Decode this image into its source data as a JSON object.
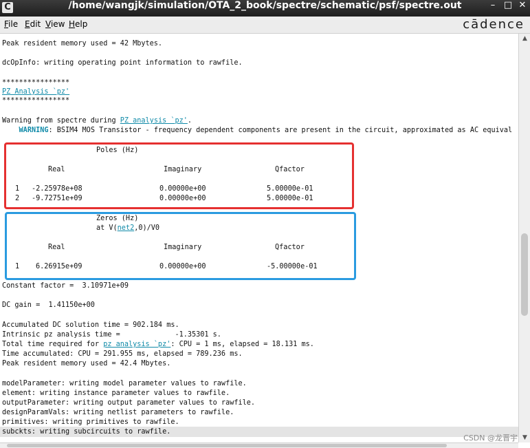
{
  "window": {
    "title": "/home/wangjk/simulation/OTA_2_book/spectre/schematic/psf/spectre.out",
    "controls": {
      "minimize": "–",
      "maximize": "□",
      "close": "✕"
    }
  },
  "menubar": {
    "file": {
      "u": "F",
      "rest": "ile"
    },
    "edit": {
      "u": "E",
      "rest": "dit"
    },
    "view": {
      "u": "V",
      "rest": "iew"
    },
    "help": {
      "u": "H",
      "rest": "elp"
    },
    "brand": "cādence"
  },
  "log": {
    "l1": "Peak resident memory used = 42 Mbytes.",
    "l2": "dcOpInfo: writing operating point information to rawfile.",
    "stars": "****************",
    "pz_heading": "PZ Analysis `pz'",
    "warn_prefix": "Warning from spectre during ",
    "warn_link": "PZ analysis `pz'",
    "warn_suffix": ".",
    "warning_label": "WARNING",
    "warning_text": ": BSIM4 MOS Transistor - frequency dependent components are present in the circuit, approximated as AC equival"
  },
  "poles": {
    "title": "Poles (Hz)",
    "headers": {
      "real": "Real",
      "imag": "Imaginary",
      "q": "Qfactor"
    },
    "rows": [
      {
        "idx": "1",
        "real": "-2.25978e+08",
        "imag": "0.00000e+00",
        "q": "5.00000e-01"
      },
      {
        "idx": "2",
        "real": "-9.72751e+09",
        "imag": "0.00000e+00",
        "q": "5.00000e-01"
      }
    ]
  },
  "zeros": {
    "title": "Zeros (Hz)",
    "at_prefix": "at V(",
    "at_link": "net2",
    "at_suffix": ",0)/V0",
    "headers": {
      "real": "Real",
      "imag": "Imaginary",
      "q": "Qfactor"
    },
    "rows": [
      {
        "idx": "1",
        "real": "6.26915e+09",
        "imag": "0.00000e+00",
        "q": "-5.00000e-01"
      }
    ]
  },
  "tail": {
    "constant": "Constant factor =  3.10971e+09",
    "dcgain": "DC gain =  1.41150e+00",
    "acc_dc": "Accumulated DC solution time = 902.184 ms.",
    "intrinsic": "Intrinsic pz analysis time =             -1.35301 s.",
    "total_prefix": "Total time required for ",
    "total_link": "pz analysis `pz'",
    "total_suffix": ": CPU = 1 ms, elapsed = 18.131 ms.",
    "time_acc": "Time accumulated: CPU = 291.955 ms, elapsed = 789.236 ms.",
    "peak2": "Peak resident memory used = 42.4 Mbytes.",
    "model": "modelParameter: writing model parameter values to rawfile.",
    "element": "element: writing instance parameter values to rawfile.",
    "output": "outputParameter: writing output parameter values to rawfile.",
    "design": "designParamVals: writing netlist parameters to rawfile.",
    "primitives": "primitives: writing primitives to rawfile.",
    "subckts": "subckts: writing subcircuits to rawfile."
  },
  "annotations": {
    "poles_box_color": "#e53030",
    "zeros_box_color": "#2a9be0"
  },
  "watermark": "CSDN @龙晋宇"
}
